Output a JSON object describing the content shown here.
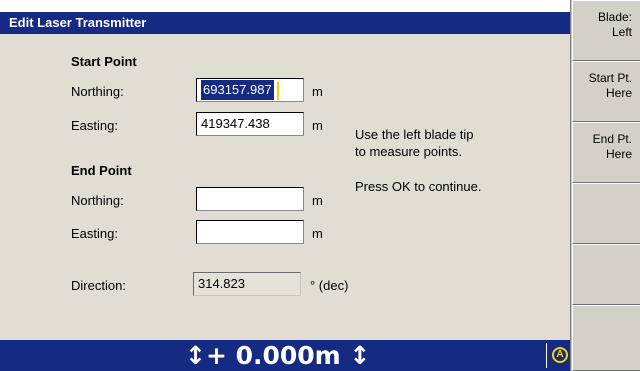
{
  "dialog": {
    "title": "Edit Laser Transmitter",
    "start_point": {
      "heading": "Start Point",
      "northing_label": "Northing:",
      "northing_value": "693157.987",
      "easting_label": "Easting:",
      "easting_value": "419347.438",
      "unit": "m"
    },
    "end_point": {
      "heading": "End Point",
      "northing_label": "Northing:",
      "northing_value": "",
      "easting_label": "Easting:",
      "easting_value": "",
      "unit": "m"
    },
    "direction": {
      "label": "Direction:",
      "value": "314.823",
      "unit": "° (dec)"
    },
    "info_line1": "Use the left blade tip",
    "info_line2": "to measure points.",
    "info_line3": "Press OK to continue."
  },
  "statusbar": {
    "value": "↕+ 0.000m ↕",
    "icon": "A"
  },
  "sidebar": {
    "buttons": [
      {
        "line1": "Blade:",
        "line2": "Left"
      },
      {
        "line1": "Start Pt.",
        "line2": "Here"
      },
      {
        "line1": "End Pt.",
        "line2": "Here"
      },
      {
        "line1": "",
        "line2": ""
      },
      {
        "line1": "",
        "line2": ""
      },
      {
        "line1": "",
        "line2": ""
      }
    ]
  },
  "colors": {
    "titlebar": "#152a83",
    "background": "#e1ddd3",
    "caret": "#f3d400"
  }
}
